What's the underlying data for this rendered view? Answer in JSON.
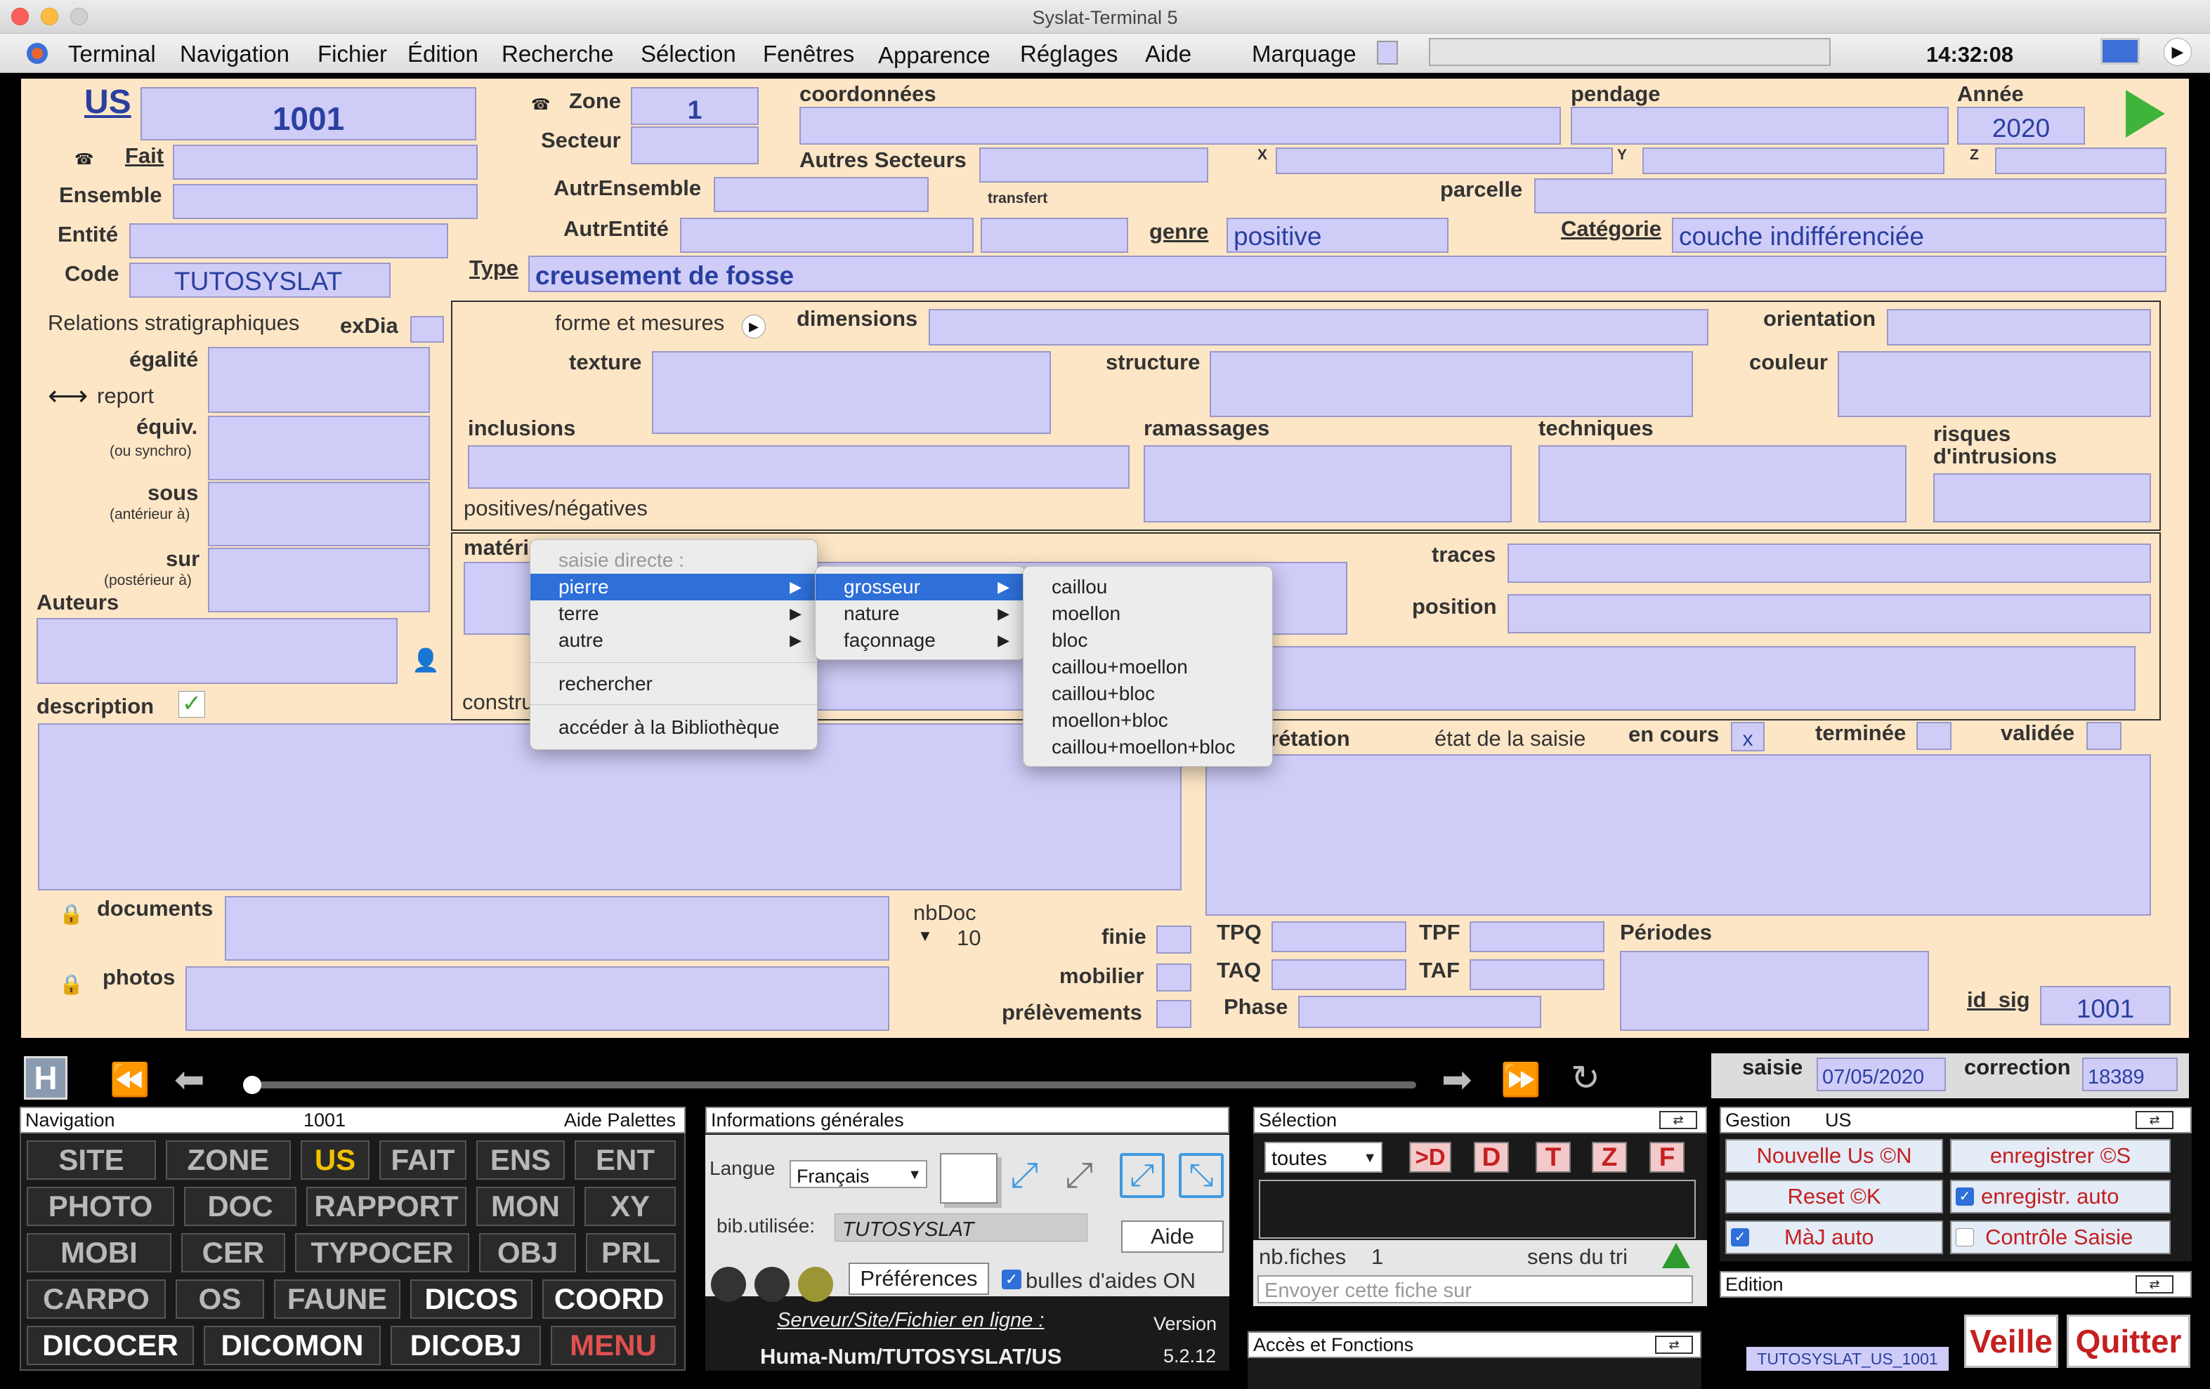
{
  "window": {
    "title": "Syslat-Terminal 5",
    "clock": "14:32:08"
  },
  "menubar": [
    "Terminal",
    "Navigation",
    "Fichier",
    "Édition",
    "Recherche",
    "Sélection",
    "Fenêtres",
    "Apparence",
    "Réglages",
    "Aide",
    "Marquage"
  ],
  "form": {
    "us_label": "US",
    "us_value": "1001",
    "zone_label": "Zone",
    "zone_value": "1",
    "secteur_label": "Secteur",
    "fait_label": "Fait",
    "ensemble_label": "Ensemble",
    "entite_label": "Entité",
    "code_label": "Code",
    "code_value": "TUTOSYSLAT",
    "coordonnees_label": "coordonnées",
    "pendage_label": "pendage",
    "annee_label": "Année",
    "annee_value": "2020",
    "autres_secteurs_label": "Autres Secteurs",
    "x_label": "X",
    "y_label": "Y",
    "z_label": "Z",
    "autrensemble_label": "AutrEnsemble",
    "transfert_label": "transfert",
    "parcelle_label": "parcelle",
    "autrentite_label": "AutrEntité",
    "genre_label": "genre",
    "genre_value": "positive",
    "categorie_label": "Catégorie",
    "categorie_value": "couche indifférenciée",
    "type_label": "Type",
    "type_value": "creusement de fosse",
    "relations_label": "Relations stratigraphiques",
    "exdia_label": "exDia",
    "egalite_label": "égalité",
    "report_label": "report",
    "equiv_label": "équiv.",
    "equiv_sub": "(ou synchro)",
    "sous_label": "sous",
    "sous_sub": "(antérieur à)",
    "sur_label": "sur",
    "sur_sub": "(postérieur à)",
    "auteurs_label": "Auteurs",
    "description_label": "description",
    "forme_label": "forme et mesures",
    "dimensions_label": "dimensions",
    "orientation_label": "orientation",
    "texture_label": "texture",
    "structure_label": "structure",
    "couleur_label": "couleur",
    "inclusions_label": "inclusions",
    "ramassages_label": "ramassages",
    "techniques_label": "techniques",
    "risques_label_1": "risques",
    "risques_label_2": "d'intrusions",
    "positives_label": "positives/négatives",
    "materiaux_label": "matéri",
    "traces_label": "traces",
    "position_label": "position",
    "construction_label": "constru",
    "interpretation_label": "rétation",
    "etat_label": "état de la saisie",
    "encours_label": "en cours",
    "encours_value": "x",
    "terminee_label": "terminée",
    "validee_label": "validée",
    "documents_label": "documents",
    "photos_label": "photos",
    "nbdoc_label": "nbDoc",
    "nbdoc_value": "10",
    "finie_label": "finie",
    "mobilier_label": "mobilier",
    "prelevements_label": "prélèvements",
    "tpq_label": "TPQ",
    "tpf_label": "TPF",
    "taq_label": "TAQ",
    "taf_label": "TAF",
    "phase_label": "Phase",
    "periodes_label": "Périodes",
    "idsig_label": "id_sig",
    "idsig_value": "1001"
  },
  "context_menu": {
    "main": [
      "saisie directe :",
      "pierre",
      "terre",
      "autre",
      "rechercher",
      "accéder à la Bibliothèque"
    ],
    "sub1": [
      "grosseur",
      "nature",
      "façonnage"
    ],
    "sub2": [
      "caillou",
      "moellon",
      "bloc",
      "caillou+moellon",
      "caillou+bloc",
      "moellon+bloc",
      "caillou+moellon+bloc"
    ]
  },
  "bottom": {
    "saisie_label": "saisie",
    "saisie_value": "07/05/2020",
    "correction_label": "correction",
    "correction_value": "18389",
    "nav_title": "Navigation",
    "nav_current": "1001",
    "nav_aide": "Aide Palettes",
    "nav_buttons": [
      "SITE",
      "ZONE",
      "US",
      "FAIT",
      "ENS",
      "ENT",
      "PHOTO",
      "DOC",
      "RAPPORT",
      "MON",
      "XY",
      "MOBI",
      "CER",
      "TYPOCER",
      "OBJ",
      "PRL",
      "CARPO",
      "OS",
      "FAUNE",
      "DICOS",
      "COORD",
      "DICOCER",
      "DICOMON",
      "DICOBJ",
      "MENU"
    ],
    "info_title": "Informations générales",
    "langue_label": "Langue",
    "langue_value": "Français",
    "bib_label": "bib.utilisée:",
    "bib_value": "TUTOSYSLAT",
    "aide_btn": "Aide",
    "preferences_btn": "Préférences",
    "bulles_label": "bulles d'aides ON",
    "serveur_label": "Serveur/Site/Fichier en ligne :",
    "version_label": "Version",
    "path_value": "Huma-Num/TUTOSYSLAT/US",
    "version_value": "5.2.12",
    "selection_title": "Sélection",
    "selection_value": "toutes",
    "sel_buttons": [
      ">D",
      "D",
      "T",
      "Z",
      "F"
    ],
    "nbfiches_label": "nb.fiches",
    "nbfiches_value": "1",
    "sens_label": "sens du tri",
    "envoyer_placeholder": "Envoyer cette fiche sur",
    "acces_title": "Accès et Fonctions",
    "gestion_title": "Gestion",
    "gestion_sub": "US",
    "nouvelle_btn": "Nouvelle Us ©N",
    "enregistrer_btn": "enregistrer ©S",
    "reset_btn": "Reset ©K",
    "enregistr_auto": "enregistr. auto",
    "maj_auto": "MàJ auto",
    "controle_saisie": "Contrôle Saisie",
    "edition_title": "Edition",
    "file_label": "TUTOSYSLAT_US_1001",
    "veille_btn": "Veille",
    "quitter_btn": "Quitter"
  },
  "colors": {
    "form_bg": "#fde6c6",
    "field": "#cfcdf8",
    "accent": "#2e6fd8",
    "nav_yellow": "#f2c200",
    "nav_red": "#e05050"
  }
}
